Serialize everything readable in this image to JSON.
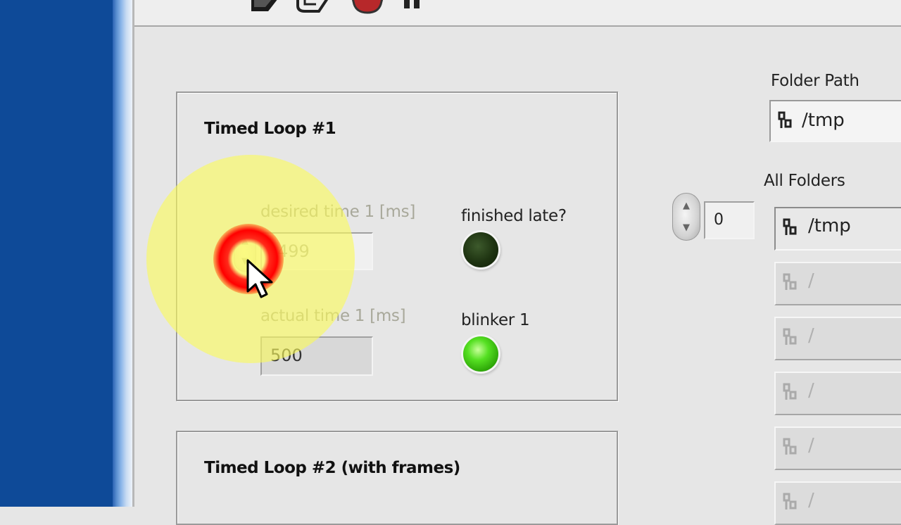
{
  "toolbar": {
    "icons": [
      "run-arrow-icon",
      "run-continuously-icon",
      "abort-icon",
      "pause-icon"
    ]
  },
  "timed_loop_1": {
    "title": "Timed Loop #1",
    "desired_label": "desired time 1 [ms]",
    "desired_value": "499",
    "actual_label": "actual time 1 [ms]",
    "actual_value": "500",
    "late_label": "finished late?",
    "late_state": "off",
    "blinker_label": "blinker 1",
    "blinker_state": "on"
  },
  "timed_loop_2": {
    "title": "Timed Loop #2 (with frames)"
  },
  "folder_path": {
    "label": "Folder Path",
    "value": "/tmp"
  },
  "all_folders": {
    "label": "All Folders",
    "index": "0",
    "items": [
      "/tmp",
      "/",
      "/",
      "/",
      "/",
      "/"
    ]
  },
  "colors": {
    "led_off": "#1e3311",
    "led_on": "#55e022",
    "desktop": "#0e4a98",
    "panel": "#e6e6e6"
  }
}
